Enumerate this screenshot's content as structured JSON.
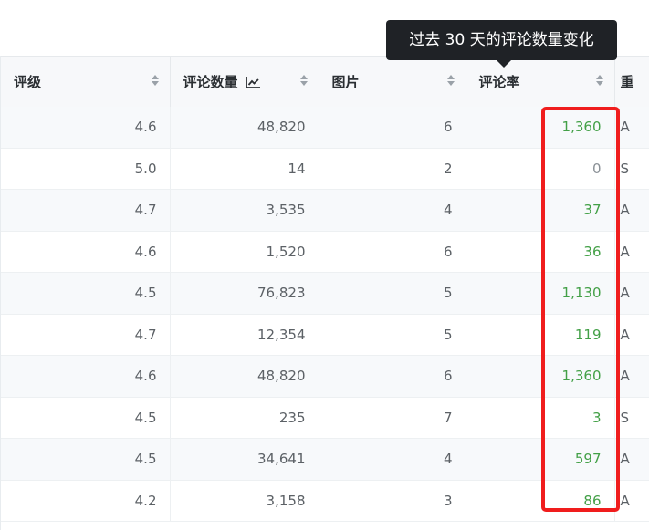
{
  "tooltip": "过去 30 天的评论数量变化",
  "columns": [
    "评级",
    "评论数量",
    "图片",
    "评论率",
    "重"
  ],
  "rows": [
    {
      "rating": "4.6",
      "reviews": "48,820",
      "images": "6",
      "rate": "1,360",
      "next": "A"
    },
    {
      "rating": "5.0",
      "reviews": "14",
      "images": "2",
      "rate": "0",
      "next": "S"
    },
    {
      "rating": "4.7",
      "reviews": "3,535",
      "images": "4",
      "rate": "37",
      "next": "A"
    },
    {
      "rating": "4.6",
      "reviews": "1,520",
      "images": "6",
      "rate": "36",
      "next": "A"
    },
    {
      "rating": "4.5",
      "reviews": "76,823",
      "images": "5",
      "rate": "1,130",
      "next": "A"
    },
    {
      "rating": "4.7",
      "reviews": "12,354",
      "images": "5",
      "rate": "119",
      "next": "A"
    },
    {
      "rating": "4.6",
      "reviews": "48,820",
      "images": "6",
      "rate": "1,360",
      "next": "A"
    },
    {
      "rating": "4.5",
      "reviews": "235",
      "images": "7",
      "rate": "3",
      "next": "S"
    },
    {
      "rating": "4.5",
      "reviews": "34,641",
      "images": "4",
      "rate": "597",
      "next": "A"
    },
    {
      "rating": "4.2",
      "reviews": "3,158",
      "images": "3",
      "rate": "86",
      "next": "A"
    }
  ],
  "colors": {
    "rate_positive": "#43a047",
    "highlight": "#f01d1d",
    "tooltip_bg": "#1f2226"
  },
  "icons": {
    "sort": "sort-icon",
    "trend": "trend-chart-icon"
  }
}
